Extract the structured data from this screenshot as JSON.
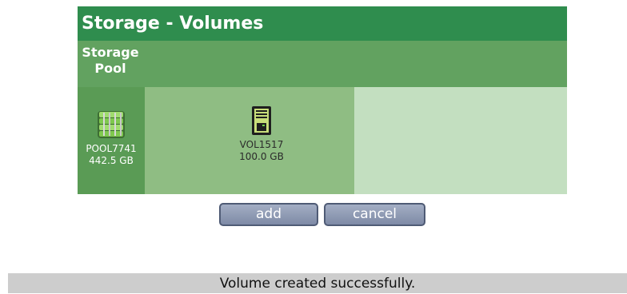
{
  "header": {
    "title": "Storage - Volumes",
    "subheader": "Storage\nPool"
  },
  "pool": {
    "name": "POOL7741",
    "size": "442.5 GB",
    "icon": "database-stack-icon"
  },
  "volumes": [
    {
      "name": "VOL1517",
      "size": "100.0 GB",
      "icon": "server-tower-icon"
    }
  ],
  "buttons": {
    "add": "add",
    "cancel": "cancel"
  },
  "status": {
    "message": "Volume created successfully."
  },
  "colors": {
    "title_bg": "#2f8d4e",
    "subheader_bg": "#62a260",
    "pool_bg": "#5a9b55",
    "volume_bg": "#8fbd83",
    "empty_bg": "#c3dfc0",
    "status_bg": "#cdcdcd"
  }
}
